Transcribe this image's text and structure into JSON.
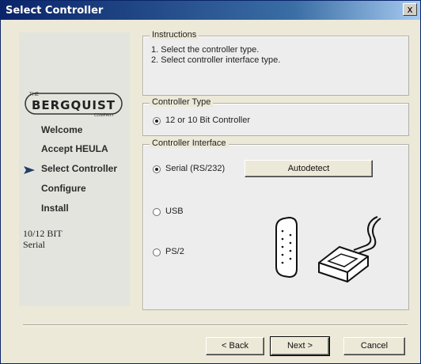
{
  "window": {
    "title": "Select Controller",
    "close_glyph": "x"
  },
  "logo": {
    "small_top": "THE",
    "brand": "BERGQUIST",
    "small_bottom": "COMPANY"
  },
  "steps": [
    {
      "label": "Welcome",
      "current": false
    },
    {
      "label": "Accept HEULA",
      "current": false
    },
    {
      "label": "Select Controller",
      "current": true
    },
    {
      "label": "Configure",
      "current": false
    },
    {
      "label": "Install",
      "current": false
    }
  ],
  "side_note": {
    "line1": "10/12 BIT",
    "line2": "Serial"
  },
  "instructions": {
    "legend": "Instructions",
    "line1": "1. Select the controller type.",
    "line2": "2. Select controller interface type."
  },
  "controller_type": {
    "legend": "Controller Type",
    "option": "12 or 10 Bit Controller"
  },
  "controller_interface": {
    "legend": "Controller Interface",
    "serial": "Serial (RS/232)",
    "usb": "USB",
    "ps2": "PS/2",
    "autodetect": "Autodetect",
    "selected": "serial"
  },
  "footer": {
    "back": "< Back",
    "next": "Next >",
    "cancel": "Cancel"
  },
  "colors": {
    "title_start": "#0a246a",
    "title_end": "#a6caf0",
    "face": "#ece9d8"
  }
}
